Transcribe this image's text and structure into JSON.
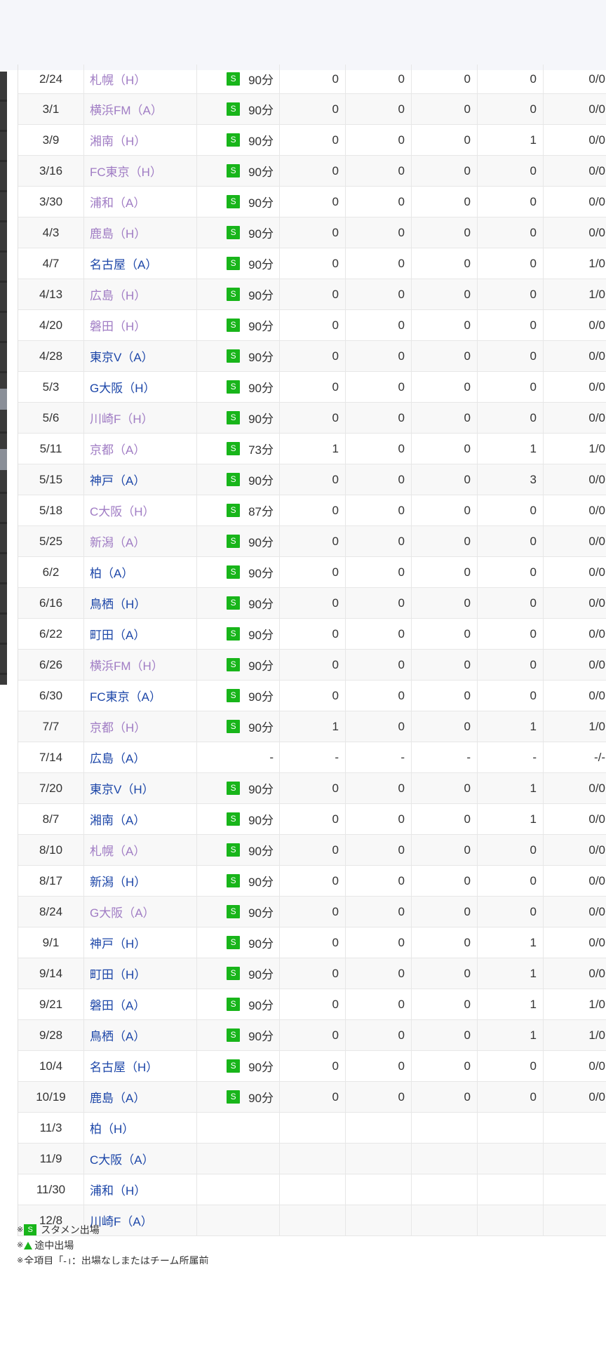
{
  "matches": [
    {
      "date": "2/24",
      "opponent": "札幌（H）",
      "venue": "home",
      "badge": "S",
      "minutes": "90分",
      "v1": "0",
      "v2": "0",
      "v3": "0",
      "v4": "0",
      "v5": "0/0"
    },
    {
      "date": "3/1",
      "opponent": "横浜FM（A）",
      "venue": "home",
      "badge": "S",
      "minutes": "90分",
      "v1": "0",
      "v2": "0",
      "v3": "0",
      "v4": "0",
      "v5": "0/0"
    },
    {
      "date": "3/9",
      "opponent": "湘南（H）",
      "venue": "home",
      "badge": "S",
      "minutes": "90分",
      "v1": "0",
      "v2": "0",
      "v3": "0",
      "v4": "1",
      "v5": "0/0"
    },
    {
      "date": "3/16",
      "opponent": "FC東京（H）",
      "venue": "home",
      "badge": "S",
      "minutes": "90分",
      "v1": "0",
      "v2": "0",
      "v3": "0",
      "v4": "0",
      "v5": "0/0"
    },
    {
      "date": "3/30",
      "opponent": "浦和（A）",
      "venue": "home",
      "badge": "S",
      "minutes": "90分",
      "v1": "0",
      "v2": "0",
      "v3": "0",
      "v4": "0",
      "v5": "0/0"
    },
    {
      "date": "4/3",
      "opponent": "鹿島（H）",
      "venue": "home",
      "badge": "S",
      "minutes": "90分",
      "v1": "0",
      "v2": "0",
      "v3": "0",
      "v4": "0",
      "v5": "0/0"
    },
    {
      "date": "4/7",
      "opponent": "名古屋（A）",
      "venue": "away",
      "badge": "S",
      "minutes": "90分",
      "v1": "0",
      "v2": "0",
      "v3": "0",
      "v4": "0",
      "v5": "1/0"
    },
    {
      "date": "4/13",
      "opponent": "広島（H）",
      "venue": "home",
      "badge": "S",
      "minutes": "90分",
      "v1": "0",
      "v2": "0",
      "v3": "0",
      "v4": "0",
      "v5": "1/0"
    },
    {
      "date": "4/20",
      "opponent": "磐田（H）",
      "venue": "home",
      "badge": "S",
      "minutes": "90分",
      "v1": "0",
      "v2": "0",
      "v3": "0",
      "v4": "0",
      "v5": "0/0"
    },
    {
      "date": "4/28",
      "opponent": "東京V（A）",
      "venue": "away",
      "badge": "S",
      "minutes": "90分",
      "v1": "0",
      "v2": "0",
      "v3": "0",
      "v4": "0",
      "v5": "0/0"
    },
    {
      "date": "5/3",
      "opponent": "G大阪（H）",
      "venue": "away",
      "badge": "S",
      "minutes": "90分",
      "v1": "0",
      "v2": "0",
      "v3": "0",
      "v4": "0",
      "v5": "0/0"
    },
    {
      "date": "5/6",
      "opponent": "川崎F（H）",
      "venue": "home",
      "badge": "S",
      "minutes": "90分",
      "v1": "0",
      "v2": "0",
      "v3": "0",
      "v4": "0",
      "v5": "0/0"
    },
    {
      "date": "5/11",
      "opponent": "京都（A）",
      "venue": "home",
      "badge": "S",
      "minutes": "73分",
      "v1": "1",
      "v2": "0",
      "v3": "0",
      "v4": "1",
      "v5": "1/0"
    },
    {
      "date": "5/15",
      "opponent": "神戸（A）",
      "venue": "away",
      "badge": "S",
      "minutes": "90分",
      "v1": "0",
      "v2": "0",
      "v3": "0",
      "v4": "3",
      "v5": "0/0"
    },
    {
      "date": "5/18",
      "opponent": "C大阪（H）",
      "venue": "home",
      "badge": "S",
      "minutes": "87分",
      "v1": "0",
      "v2": "0",
      "v3": "0",
      "v4": "0",
      "v5": "0/0"
    },
    {
      "date": "5/25",
      "opponent": "新潟（A）",
      "venue": "home",
      "badge": "S",
      "minutes": "90分",
      "v1": "0",
      "v2": "0",
      "v3": "0",
      "v4": "0",
      "v5": "0/0"
    },
    {
      "date": "6/2",
      "opponent": "柏（A）",
      "venue": "away",
      "badge": "S",
      "minutes": "90分",
      "v1": "0",
      "v2": "0",
      "v3": "0",
      "v4": "0",
      "v5": "0/0"
    },
    {
      "date": "6/16",
      "opponent": "鳥栖（H）",
      "venue": "away",
      "badge": "S",
      "minutes": "90分",
      "v1": "0",
      "v2": "0",
      "v3": "0",
      "v4": "0",
      "v5": "0/0"
    },
    {
      "date": "6/22",
      "opponent": "町田（A）",
      "venue": "away",
      "badge": "S",
      "minutes": "90分",
      "v1": "0",
      "v2": "0",
      "v3": "0",
      "v4": "0",
      "v5": "0/0"
    },
    {
      "date": "6/26",
      "opponent": "横浜FM（H）",
      "venue": "home",
      "badge": "S",
      "minutes": "90分",
      "v1": "0",
      "v2": "0",
      "v3": "0",
      "v4": "0",
      "v5": "0/0"
    },
    {
      "date": "6/30",
      "opponent": "FC東京（A）",
      "venue": "away",
      "badge": "S",
      "minutes": "90分",
      "v1": "0",
      "v2": "0",
      "v3": "0",
      "v4": "0",
      "v5": "0/0"
    },
    {
      "date": "7/7",
      "opponent": "京都（H）",
      "venue": "home",
      "badge": "S",
      "minutes": "90分",
      "v1": "1",
      "v2": "0",
      "v3": "0",
      "v4": "1",
      "v5": "1/0"
    },
    {
      "date": "7/14",
      "opponent": "広島（A）",
      "venue": "away",
      "badge": "",
      "minutes": "-",
      "v1": "-",
      "v2": "-",
      "v3": "-",
      "v4": "-",
      "v5": "-/-"
    },
    {
      "date": "7/20",
      "opponent": "東京V（H）",
      "venue": "away",
      "badge": "S",
      "minutes": "90分",
      "v1": "0",
      "v2": "0",
      "v3": "0",
      "v4": "1",
      "v5": "0/0"
    },
    {
      "date": "8/7",
      "opponent": "湘南（A）",
      "venue": "away",
      "badge": "S",
      "minutes": "90分",
      "v1": "0",
      "v2": "0",
      "v3": "0",
      "v4": "1",
      "v5": "0/0"
    },
    {
      "date": "8/10",
      "opponent": "札幌（A）",
      "venue": "home",
      "badge": "S",
      "minutes": "90分",
      "v1": "0",
      "v2": "0",
      "v3": "0",
      "v4": "0",
      "v5": "0/0"
    },
    {
      "date": "8/17",
      "opponent": "新潟（H）",
      "venue": "away",
      "badge": "S",
      "minutes": "90分",
      "v1": "0",
      "v2": "0",
      "v3": "0",
      "v4": "0",
      "v5": "0/0"
    },
    {
      "date": "8/24",
      "opponent": "G大阪（A）",
      "venue": "home",
      "badge": "S",
      "minutes": "90分",
      "v1": "0",
      "v2": "0",
      "v3": "0",
      "v4": "0",
      "v5": "0/0"
    },
    {
      "date": "9/1",
      "opponent": "神戸（H）",
      "venue": "away",
      "badge": "S",
      "minutes": "90分",
      "v1": "0",
      "v2": "0",
      "v3": "0",
      "v4": "1",
      "v5": "0/0"
    },
    {
      "date": "9/14",
      "opponent": "町田（H）",
      "venue": "away",
      "badge": "S",
      "minutes": "90分",
      "v1": "0",
      "v2": "0",
      "v3": "0",
      "v4": "1",
      "v5": "0/0"
    },
    {
      "date": "9/21",
      "opponent": "磐田（A）",
      "venue": "away",
      "badge": "S",
      "minutes": "90分",
      "v1": "0",
      "v2": "0",
      "v3": "0",
      "v4": "1",
      "v5": "1/0"
    },
    {
      "date": "9/28",
      "opponent": "鳥栖（A）",
      "venue": "away",
      "badge": "S",
      "minutes": "90分",
      "v1": "0",
      "v2": "0",
      "v3": "0",
      "v4": "1",
      "v5": "1/0"
    },
    {
      "date": "10/4",
      "opponent": "名古屋（H）",
      "venue": "away",
      "badge": "S",
      "minutes": "90分",
      "v1": "0",
      "v2": "0",
      "v3": "0",
      "v4": "0",
      "v5": "0/0"
    },
    {
      "date": "10/19",
      "opponent": "鹿島（A）",
      "venue": "away",
      "badge": "S",
      "minutes": "90分",
      "v1": "0",
      "v2": "0",
      "v3": "0",
      "v4": "0",
      "v5": "0/0"
    },
    {
      "date": "11/3",
      "opponent": "柏（H）",
      "venue": "away",
      "badge": "",
      "minutes": "",
      "v1": "",
      "v2": "",
      "v3": "",
      "v4": "",
      "v5": ""
    },
    {
      "date": "11/9",
      "opponent": "C大阪（A）",
      "venue": "away",
      "badge": "",
      "minutes": "",
      "v1": "",
      "v2": "",
      "v3": "",
      "v4": "",
      "v5": ""
    },
    {
      "date": "11/30",
      "opponent": "浦和（H）",
      "venue": "away",
      "badge": "",
      "minutes": "",
      "v1": "",
      "v2": "",
      "v3": "",
      "v4": "",
      "v5": ""
    },
    {
      "date": "12/8",
      "opponent": "川崎F（A）",
      "venue": "away",
      "badge": "",
      "minutes": "",
      "v1": "",
      "v2": "",
      "v3": "",
      "v4": "",
      "v5": ""
    }
  ],
  "footnotes": {
    "mark": "※",
    "starter_badge": "S",
    "starter_text": "スタメン出場",
    "sub_text": "途中出場",
    "dash_text": "全項目「-」：出場なしまたはチーム所属前"
  },
  "colors": {
    "badge": "#18b51a",
    "link_home": "#a07cc4",
    "link_away": "#1c46a8",
    "header_bg": "#f5f6fa"
  },
  "icons": {
    "starter": "starter-badge-icon",
    "substitute": "substitute-triangle-icon"
  }
}
